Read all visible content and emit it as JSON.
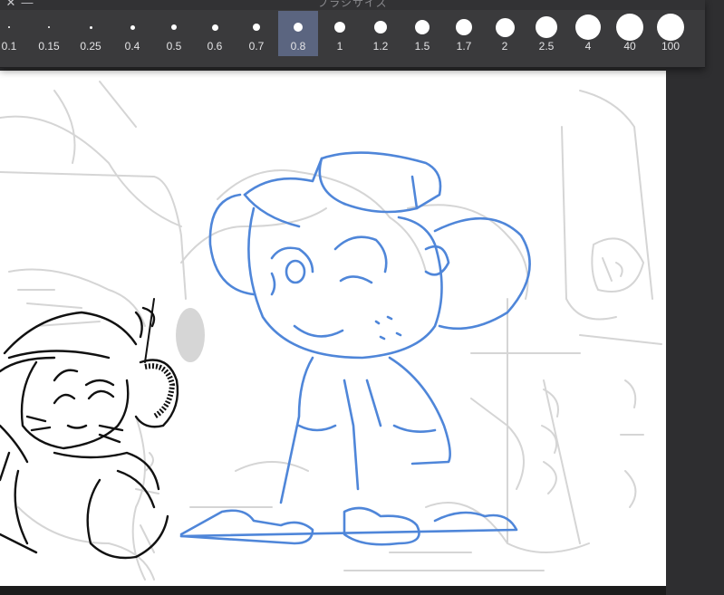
{
  "panel": {
    "title": "ブラシサイズ",
    "close_icon": "close-icon",
    "minimize_icon": "minimize-icon",
    "selected_index": 7,
    "selected_color": "#5b6580",
    "sizes": [
      {
        "label": "0.1"
      },
      {
        "label": "0.15"
      },
      {
        "label": "0.25"
      },
      {
        "label": "0.4"
      },
      {
        "label": "0.5"
      },
      {
        "label": "0.6"
      },
      {
        "label": "0.7"
      },
      {
        "label": "0.8"
      },
      {
        "label": "1"
      },
      {
        "label": "1.2"
      },
      {
        "label": "1.5"
      },
      {
        "label": "1.7"
      },
      {
        "label": "2"
      },
      {
        "label": "2.5"
      },
      {
        "label": "4"
      },
      {
        "label": "40"
      },
      {
        "label": "100"
      }
    ]
  },
  "canvas": {
    "paper_color": "#ffffff",
    "blue_line_color": "#4f86d9",
    "sketch_color": "#d2d2d2",
    "ink_color": "#111111"
  }
}
